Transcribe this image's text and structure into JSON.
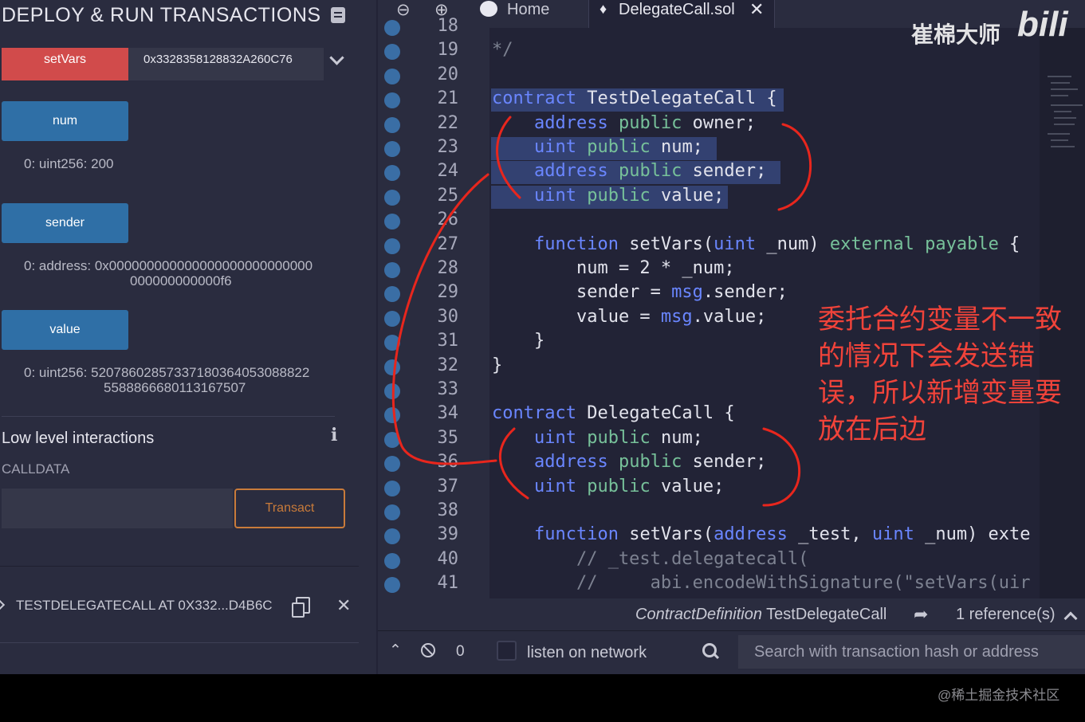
{
  "deploy_panel": {
    "title": "DEPLOY & RUN TRANSACTIONS",
    "setvars_button": "setVars",
    "setvars_input": "0x3328358128832A260C76",
    "getters": [
      {
        "label": "num",
        "output": "0: uint256: 200"
      },
      {
        "label": "sender",
        "output": "0: address: 0x000000000000000000000000000000000000f6"
      },
      {
        "label": "value",
        "output": "0: uint256: 52078602857337180364053088825588866680113167507"
      }
    ],
    "sender_output_line1": "0: address: 0x000000000000000000000000000",
    "sender_output_line2": "000000000000f6",
    "value_output_line1": "0: uint256: 52078602857337180364053088822",
    "value_output_line2": "5588866680113167507",
    "low_level_title": "Low level interactions",
    "calldata_label": "CALLDATA",
    "transact_label": "Transact",
    "deployed_contract": "TESTDELEGATECALL AT 0X332...D4B6C"
  },
  "tabs": {
    "home_label": "Home",
    "file_label": "DelegateCall.sol"
  },
  "editor": {
    "lines": [
      {
        "n": "18",
        "text": ""
      },
      {
        "n": "19",
        "text": "*/"
      },
      {
        "n": "20",
        "text": ""
      },
      {
        "n": "21",
        "text": "contract TestDelegateCall {"
      },
      {
        "n": "22",
        "text": "    address public owner;"
      },
      {
        "n": "23",
        "text": "    uint public num;"
      },
      {
        "n": "24",
        "text": "    address public sender;"
      },
      {
        "n": "25",
        "text": "    uint public value;"
      },
      {
        "n": "26",
        "text": ""
      },
      {
        "n": "27",
        "text": "    function setVars(uint _num) external payable {"
      },
      {
        "n": "28",
        "text": "        num = 2 * _num;"
      },
      {
        "n": "29",
        "text": "        sender = msg.sender;"
      },
      {
        "n": "30",
        "text": "        value = msg.value;"
      },
      {
        "n": "31",
        "text": "    }"
      },
      {
        "n": "32",
        "text": "}"
      },
      {
        "n": "33",
        "text": ""
      },
      {
        "n": "34",
        "text": "contract DelegateCall {"
      },
      {
        "n": "35",
        "text": "    uint public num;"
      },
      {
        "n": "36",
        "text": "    address public sender;"
      },
      {
        "n": "37",
        "text": "    uint public value;"
      },
      {
        "n": "38",
        "text": ""
      },
      {
        "n": "39",
        "text": "    function setVars(address _test, uint _num) exte"
      },
      {
        "n": "40",
        "text": "        // _test.delegatecall("
      },
      {
        "n": "41",
        "text": "        //     abi.encodeWithSignature(\"setVars(uir"
      }
    ]
  },
  "status": {
    "contract_definition_label": "ContractDefinition",
    "contract_definition_name": "TestDelegateCall",
    "references": "1 reference(s)"
  },
  "terminal": {
    "count": "0",
    "listen_label": "listen on network",
    "search_placeholder": "Search with transaction hash or address"
  },
  "annotation_note": "委托合约变量不一致的情况下会发送错误，所以新增变量要放在后边",
  "watermark": "崔棉大师",
  "watermark_logo": "bilibili",
  "credit": "@稀土掘金技术社区",
  "colors": {
    "accent_red": "#d14b4b",
    "button_blue": "#2f6fa6",
    "transact_orange": "#c97b3a",
    "annotation_red": "#f0433a"
  }
}
